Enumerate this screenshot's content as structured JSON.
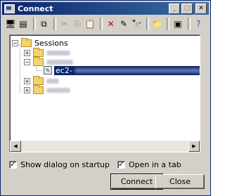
{
  "window": {
    "title": "Connect"
  },
  "titlebar": {
    "minimize": "_",
    "maximize": "□",
    "close": "✕"
  },
  "toolbar": {
    "icons": [
      "new-session-icon",
      "properties-icon",
      "clone-icon",
      "cut-icon",
      "copy-icon",
      "paste-icon",
      "delete-icon",
      "rename-icon",
      "find-icon",
      "new-folder-icon",
      "connect-icon",
      "help-icon"
    ]
  },
  "tree": {
    "root": "Sessions",
    "selected_prefix": "ec2-"
  },
  "options": {
    "show_dialog_label": "Show dialog on startup",
    "show_dialog_checked": true,
    "open_in_tab_label": "Open in a tab",
    "open_in_tab_checked": true
  },
  "buttons": {
    "connect": "Connect",
    "close": "Close"
  },
  "colors": {
    "selection": "#0a246a",
    "title_start": "#0a246a",
    "title_end": "#3a6ea5"
  }
}
